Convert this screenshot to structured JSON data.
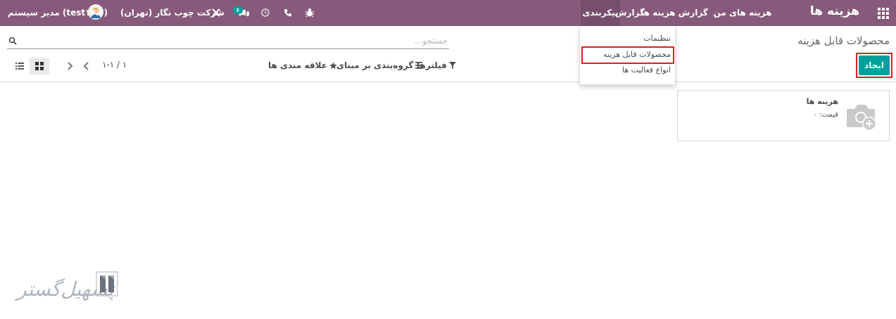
{
  "navbar": {
    "app_title": "هزینه ها",
    "menu": [
      {
        "label": "هزینه های من"
      },
      {
        "label": "گزارش هزینه ها"
      },
      {
        "label": "گزارش"
      },
      {
        "label": "پیکربندی",
        "active": true
      }
    ],
    "company": "شرکت چوب نگار (تهران)",
    "user": "مدیر سیستم (test۱۴.۰)",
    "message_count": "۶",
    "icons": [
      "apps-grid-icon",
      "bug-icon",
      "phone-icon",
      "clock-icon",
      "chat-icon",
      "tools-icon",
      "avatar"
    ]
  },
  "dropdown": {
    "items": [
      {
        "label": "تنظیمات"
      },
      {
        "label": "محصولات قابل هزینه",
        "highlighted": true
      },
      {
        "label": "انواع فعالیت ها"
      }
    ]
  },
  "control_panel": {
    "title": "محصولات قابل هزینه",
    "create_label": "ایجاد",
    "search_placeholder": "جستجو...",
    "filters_label": "فیلترها",
    "groupby_label": "گروه‌بندی بر مبنای",
    "favorites_label": "علاقه مندی ها",
    "pager": "۱-۱ / ۱"
  },
  "kanban": {
    "records": [
      {
        "name": "هزینه ها",
        "price": "قیمت: ۰"
      }
    ]
  },
  "watermark": {
    "text": "تسهیل‌گستر"
  },
  "colors": {
    "navbar": "#875a7b",
    "primary_button": "#00a09d",
    "highlight_box": "#e31b23"
  }
}
